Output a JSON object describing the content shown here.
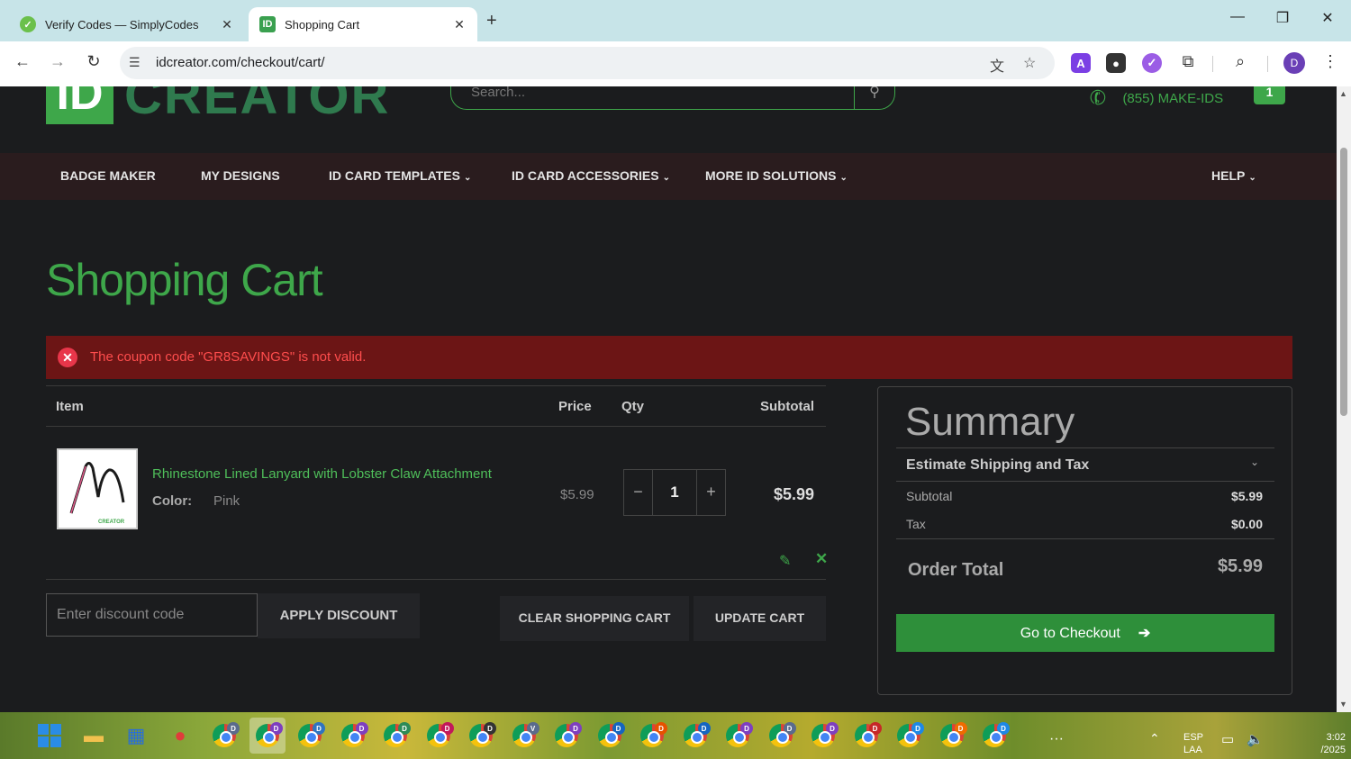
{
  "browser": {
    "tabs": [
      {
        "title": "Verify Codes — SimplyCodes",
        "favicon": "simplycodes-icon"
      },
      {
        "title": "Shopping Cart",
        "favicon": "idcreator-icon",
        "favicon_text": "ID"
      }
    ],
    "new_tab": "+",
    "url": "idcreator.com/checkout/cart/",
    "profile_initial": "D",
    "extensions": [
      {
        "name": "a-extension-icon",
        "label": "A",
        "color": "#7b3fe4"
      },
      {
        "name": "spy-extension-icon",
        "label": "●",
        "color": "#333333"
      },
      {
        "name": "simplycodes-extension-icon",
        "label": "✓",
        "color": "#9b5de5"
      }
    ]
  },
  "site": {
    "logo_badge": "ID",
    "logo_word": "CREATOR",
    "search_placeholder": "Search...",
    "phone": "(855) MAKE-IDS",
    "cart_count": "1",
    "nav": [
      {
        "label": "BADGE MAKER",
        "has_menu": false
      },
      {
        "label": "MY DESIGNS",
        "has_menu": false
      },
      {
        "label": "ID CARD TEMPLATES",
        "has_menu": true
      },
      {
        "label": "ID CARD ACCESSORIES",
        "has_menu": true
      },
      {
        "label": "MORE ID SOLUTIONS",
        "has_menu": true
      },
      {
        "label": "HELP",
        "has_menu": true
      }
    ]
  },
  "page": {
    "title": "Shopping Cart",
    "alert": "The coupon code \"GR8SAVINGS\" is not valid."
  },
  "cart": {
    "headers": {
      "item": "Item",
      "price": "Price",
      "qty": "Qty",
      "subtotal": "Subtotal"
    },
    "items": [
      {
        "name": "Rhinestone Lined Lanyard with Lobster Claw Attachment",
        "option_label": "Color:",
        "option_value": "Pink",
        "price": "$5.99",
        "qty": "1",
        "subtotal": "$5.99",
        "thumb_brand": "CREATOR"
      }
    ],
    "qty_minus": "−",
    "qty_plus": "+",
    "discount_placeholder": "Enter discount code",
    "apply_discount": "APPLY DISCOUNT",
    "clear_cart": "CLEAR SHOPPING CART",
    "update_cart": "UPDATE CART"
  },
  "summary": {
    "title": "Summary",
    "estimate": "Estimate Shipping and Tax",
    "rows": [
      {
        "label": "Subtotal",
        "value": "$5.99"
      },
      {
        "label": "Tax",
        "value": "$0.00"
      }
    ],
    "order_total_label": "Order Total",
    "order_total_value": "$5.99",
    "checkout_label": "Go to Checkout"
  },
  "taskbar": {
    "system_tray": {
      "lang_line1": "ESP",
      "lang_line2": "LAA",
      "time_fragment": "3:02",
      "date_fragment": "/2025"
    },
    "chrome_profiles": [
      {
        "initial": "D",
        "color": "#5a6b8c"
      },
      {
        "initial": "D",
        "color": "#7e3fbf"
      },
      {
        "initial": "D",
        "color": "#2f74c0"
      },
      {
        "initial": "D",
        "color": "#7e3fbf"
      },
      {
        "initial": "D",
        "color": "#2e8b57"
      },
      {
        "initial": "D",
        "color": "#c2185b"
      },
      {
        "initial": "D",
        "color": "#333333"
      },
      {
        "initial": "V",
        "color": "#5a6b8c"
      },
      {
        "initial": "D",
        "color": "#7e3fbf"
      },
      {
        "initial": "D",
        "color": "#1565c0"
      },
      {
        "initial": "D",
        "color": "#e65100"
      },
      {
        "initial": "D",
        "color": "#1565c0"
      },
      {
        "initial": "D",
        "color": "#7e3fbf"
      },
      {
        "initial": "D",
        "color": "#5a6b8c"
      },
      {
        "initial": "D",
        "color": "#7e3fbf"
      },
      {
        "initial": "D",
        "color": "#c62828"
      },
      {
        "initial": "D",
        "color": "#1e88e5"
      },
      {
        "initial": "D",
        "color": "#ef6c00"
      },
      {
        "initial": "D",
        "color": "#1e88e5"
      }
    ]
  }
}
